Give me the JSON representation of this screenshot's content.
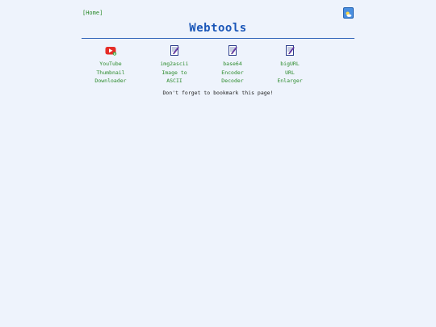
{
  "nav": {
    "home_label": "[Home]"
  },
  "header": {
    "title": "Webtools"
  },
  "theme_toggle": {
    "icon": "sun-cloud-icon"
  },
  "tools": [
    {
      "icon": "youtube-icon",
      "lines": [
        "YouTube",
        "Thumbnail",
        "Downloader"
      ]
    },
    {
      "icon": "document-pen-icon",
      "lines": [
        "img2ascii",
        "Image to",
        "ASCII"
      ]
    },
    {
      "icon": "document-pen-icon",
      "lines": [
        "base64",
        "Encoder",
        "Decoder"
      ]
    },
    {
      "icon": "document-pen-icon",
      "lines": [
        "bigURL",
        "URL",
        "Enlarger"
      ]
    }
  ],
  "footer": {
    "reminder": "Don't forget to bookmark this page!"
  },
  "colors": {
    "background": "#eef3fc",
    "title": "#1a56b8",
    "link": "#2a8a2a",
    "rule": "#2e62b8",
    "youtube_red": "#e52d27"
  }
}
